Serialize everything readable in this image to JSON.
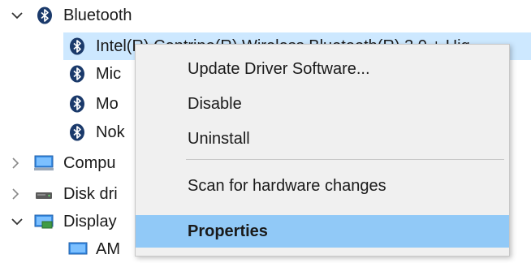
{
  "tree": {
    "bluetooth_label": "Bluetooth",
    "bluetooth_children": [
      {
        "label": "Intel(R) Centrino(R) Wireless Bluetooth(R) 3.0 + Hig"
      },
      {
        "label": "Mic"
      },
      {
        "label": "Mo"
      },
      {
        "label": "Nok"
      }
    ],
    "other_categories": [
      {
        "label": "Compu",
        "icon": "computer-icon",
        "expanded": false
      },
      {
        "label": "Disk dri",
        "icon": "disk-drive-icon",
        "expanded": false
      },
      {
        "label": "Display",
        "icon": "display-adapter-icon",
        "expanded": true
      }
    ],
    "partial_child_label": "AM"
  },
  "context_menu": {
    "items": [
      {
        "label": "Update Driver Software..."
      },
      {
        "label": "Disable"
      },
      {
        "label": "Uninstall"
      },
      {
        "label": "Scan for hardware changes"
      },
      {
        "label": "Properties",
        "highlighted": true
      }
    ]
  },
  "colors": {
    "selection": "#cde8ff",
    "menu_background": "#f0f0f0",
    "menu_highlight": "#91c9f7",
    "bluetooth_icon": "#1b3a6b"
  }
}
